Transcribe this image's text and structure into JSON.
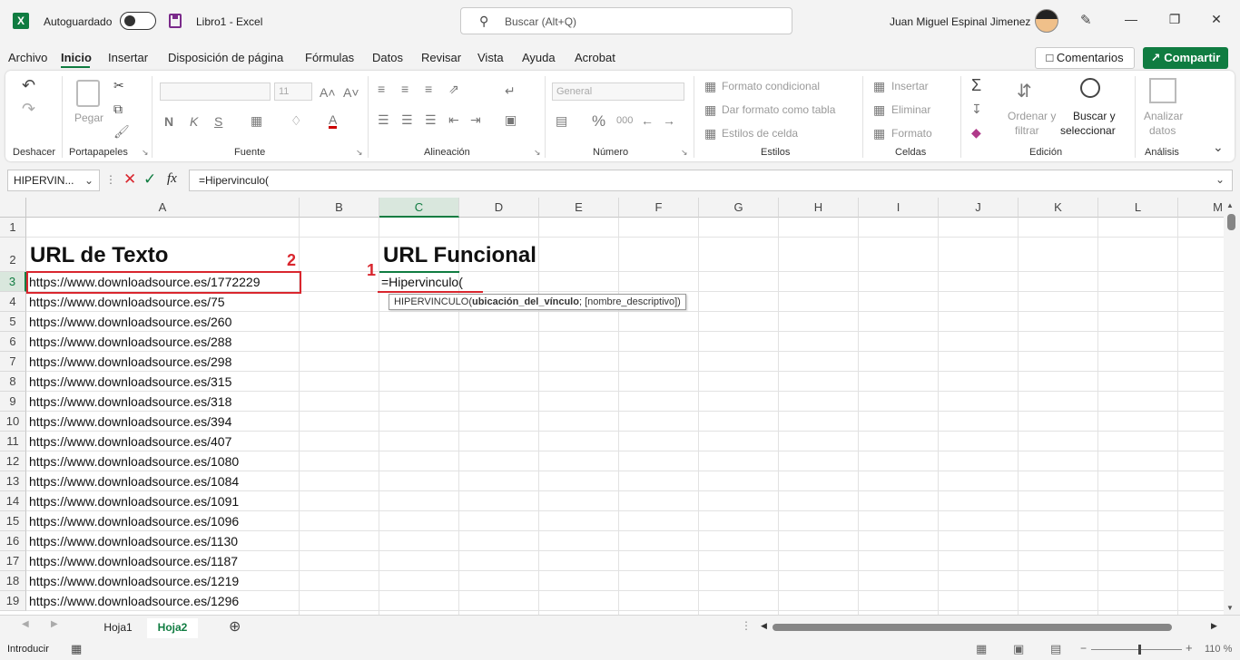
{
  "titlebar": {
    "app_logo": "X",
    "autosave_label": "Autoguardado",
    "doc_title": "Libro1  -  Excel",
    "search_placeholder": "Buscar (Alt+Q)",
    "user_name": "Juan Miguel Espinal Jimenez",
    "controls": {
      "minimize": "—",
      "restore": "❐",
      "close": "✕"
    }
  },
  "tabs": [
    "Archivo",
    "Inicio",
    "Insertar",
    "Disposición de página",
    "Fórmulas",
    "Datos",
    "Revisar",
    "Vista",
    "Ayuda",
    "Acrobat"
  ],
  "actions": {
    "comments": "Comentarios",
    "share": "Compartir"
  },
  "ribbon": {
    "groups": [
      "Deshacer",
      "Portapapeles",
      "Fuente",
      "Alineación",
      "Número",
      "Estilos",
      "Celdas",
      "Edición",
      "Análisis"
    ],
    "paste_label": "Pegar",
    "font_size": "11",
    "font_bold": "N",
    "font_italic": "K",
    "font_underline": "S",
    "font_color_letter": "A",
    "number_format": "General",
    "percent_symbol": "%",
    "thousands_symbol": "000",
    "styles": [
      "Formato condicional",
      "Dar formato como tabla",
      "Estilos de celda"
    ],
    "cells": [
      "Insertar",
      "Eliminar",
      "Formato"
    ],
    "sort_filter": [
      "Ordenar y",
      "filtrar"
    ],
    "find_select": [
      "Buscar y",
      "seleccionar"
    ],
    "analyze": [
      "Analizar",
      "datos"
    ]
  },
  "formula_bar": {
    "name_box": "HIPERVIN...",
    "fx": "fx",
    "formula": "=Hipervinculo("
  },
  "grid": {
    "columns": [
      "A",
      "B",
      "C",
      "D",
      "E",
      "F",
      "G",
      "H",
      "I",
      "J",
      "K",
      "L",
      "M"
    ],
    "rows": [
      "1",
      "2",
      "3",
      "4",
      "5",
      "6",
      "7",
      "8",
      "9",
      "10",
      "11",
      "12",
      "13",
      "14",
      "15",
      "16",
      "17",
      "18",
      "19"
    ],
    "header_a2": "URL de Texto",
    "header_c2": "URL Funcional",
    "active_cell_text": "=Hipervinculo(",
    "urls": [
      "https://www.downloadsource.es/1772229",
      "https://www.downloadsource.es/75",
      "https://www.downloadsource.es/260",
      "https://www.downloadsource.es/288",
      "https://www.downloadsource.es/298",
      "https://www.downloadsource.es/315",
      "https://www.downloadsource.es/318",
      "https://www.downloadsource.es/394",
      "https://www.downloadsource.es/407",
      "https://www.downloadsource.es/1080",
      "https://www.downloadsource.es/1084",
      "https://www.downloadsource.es/1091",
      "https://www.downloadsource.es/1096",
      "https://www.downloadsource.es/1130",
      "https://www.downloadsource.es/1187",
      "https://www.downloadsource.es/1219",
      "https://www.downloadsource.es/1296"
    ],
    "tooltip": {
      "fn": "HIPERVINCULO(",
      "arg1": "ubicación_del_vínculo",
      "rest": "; [nombre_descriptivo])"
    }
  },
  "annotations": {
    "marker_1": "1",
    "marker_2": "2"
  },
  "sheets": [
    "Hoja1",
    "Hoja2"
  ],
  "status": {
    "mode": "Introducir",
    "zoom": "110 %"
  }
}
